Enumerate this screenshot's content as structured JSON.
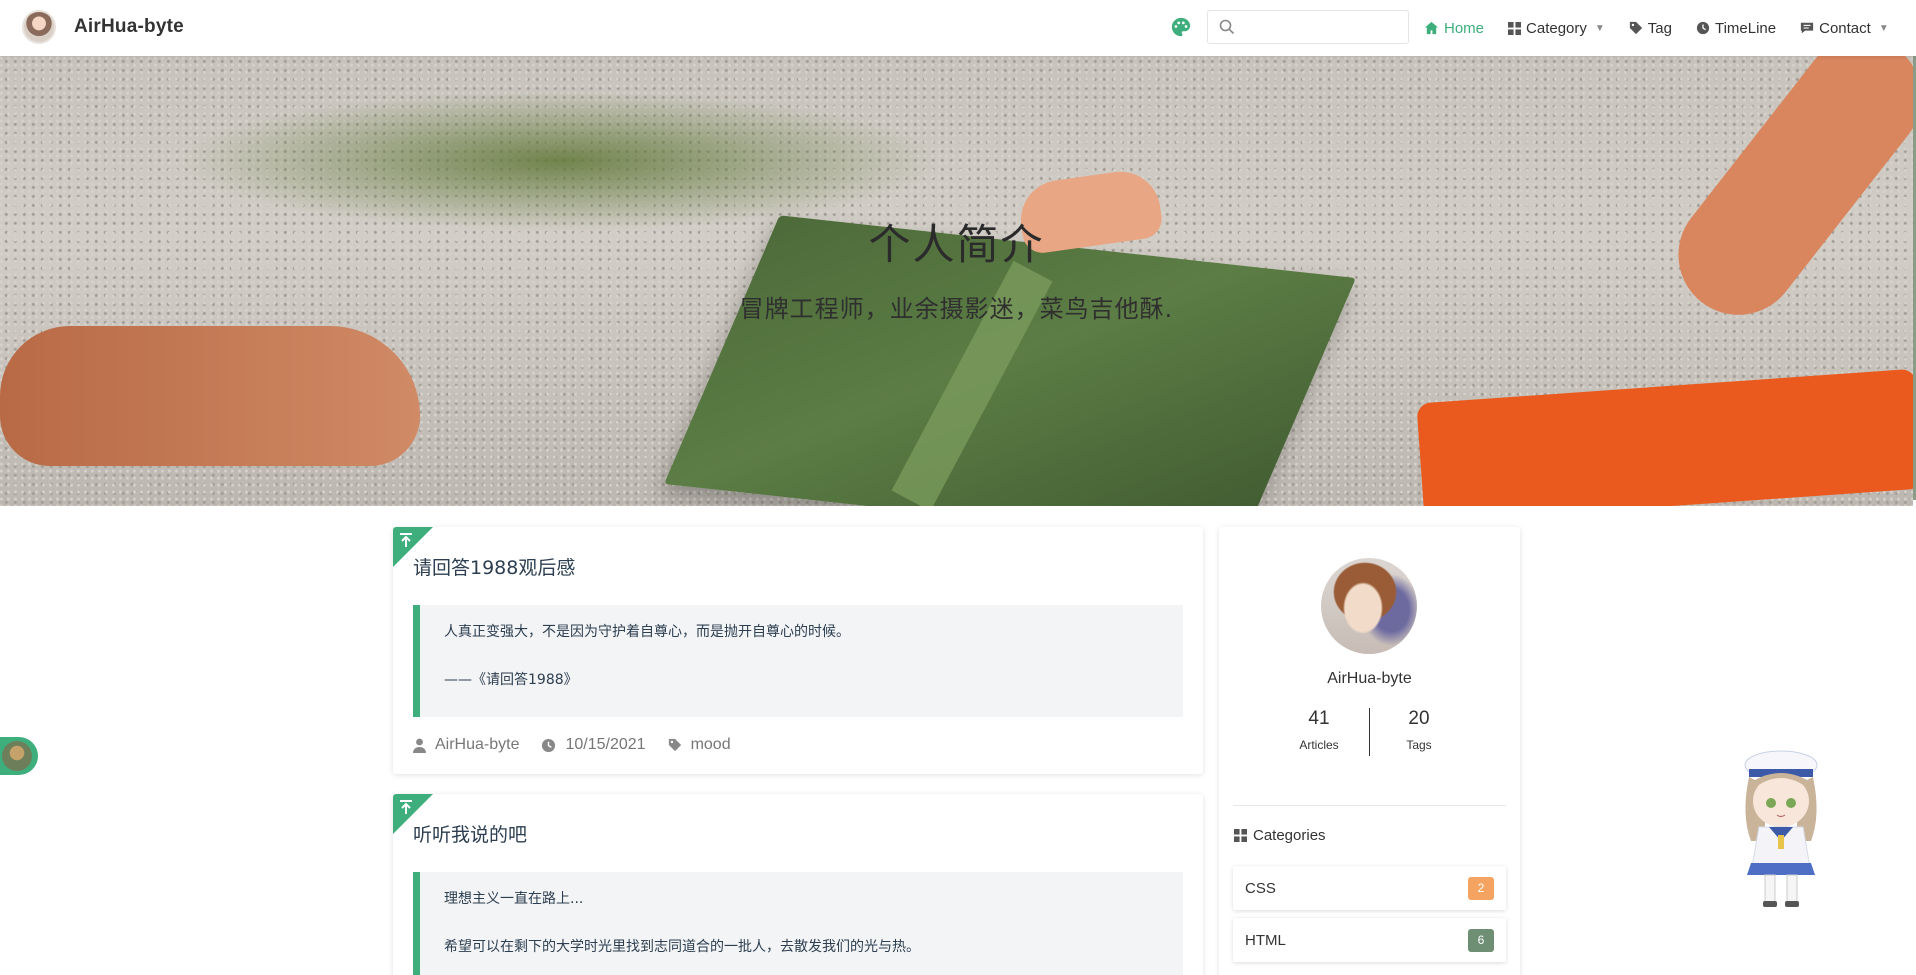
{
  "header": {
    "site_title": "AirHua-byte",
    "search": {
      "placeholder": "",
      "value": ""
    },
    "nav": [
      {
        "label": "Home",
        "icon": "home-icon",
        "active": true
      },
      {
        "label": "Category",
        "icon": "grid-icon",
        "dropdown": true
      },
      {
        "label": "Tag",
        "icon": "tag-icon"
      },
      {
        "label": "TimeLine",
        "icon": "clock-icon"
      },
      {
        "label": "Contact",
        "icon": "message-icon",
        "dropdown": true
      }
    ]
  },
  "hero": {
    "title": "个人简介",
    "subtitle": "冒牌工程师，业余摄影迷，菜鸟吉他酥."
  },
  "posts": [
    {
      "title": "请回答1988观后感",
      "quote": [
        "人真正变强大，不是因为守护着自尊心，而是抛开自尊心的时候。",
        "——《请回答1988》"
      ],
      "author": "AirHua-byte",
      "date": "10/15/2021",
      "tag": "mood"
    },
    {
      "title": "听听我说的吧",
      "quote": [
        "理想主义一直在路上...",
        "希望可以在剩下的大学时光里找到志同道合的一批人，去散发我们的光与热。"
      ]
    }
  ],
  "sidebar": {
    "name": "AirHua-byte",
    "articles": {
      "count": "41",
      "label": "Articles"
    },
    "tags": {
      "count": "20",
      "label": "Tags"
    },
    "categories_title": "Categories",
    "categories": [
      {
        "name": "CSS",
        "count": "2",
        "color": "#f4a460"
      },
      {
        "name": "HTML",
        "count": "6",
        "color": "#6f8f75"
      }
    ]
  },
  "colors": {
    "accent": "#3eaf7c",
    "text": "#2c3e50"
  }
}
